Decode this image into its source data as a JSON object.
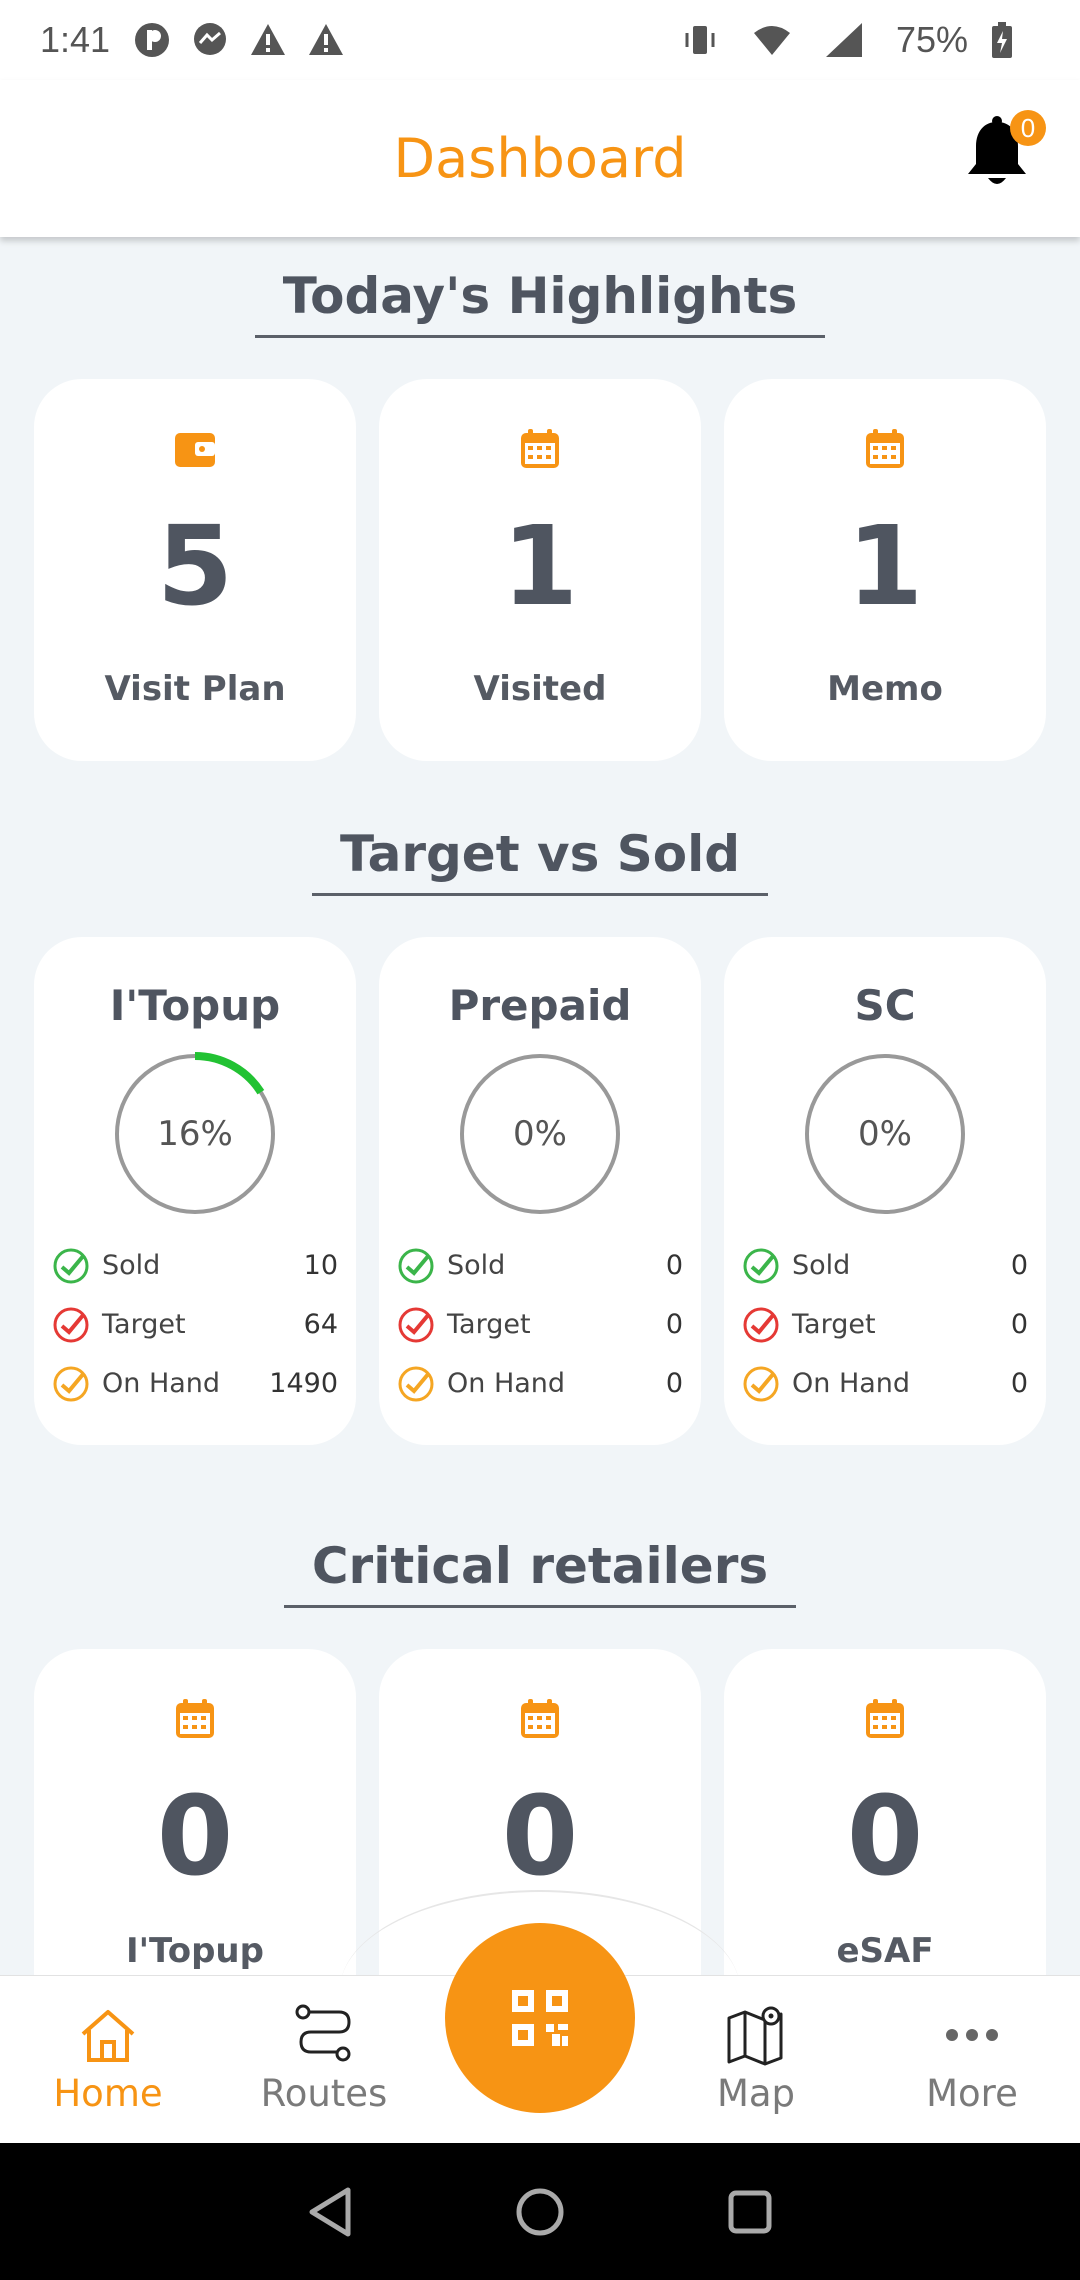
{
  "status_bar": {
    "time": "1:41",
    "battery": "75%"
  },
  "header": {
    "title": "Dashboard",
    "notification_count": "0"
  },
  "highlights": {
    "title": "Today's Highlights",
    "cards": [
      {
        "icon": "wallet-icon",
        "value": "5",
        "label": "Visit Plan"
      },
      {
        "icon": "calendar-icon",
        "value": "1",
        "label": "Visited"
      },
      {
        "icon": "calendar-icon",
        "value": "1",
        "label": "Memo"
      }
    ]
  },
  "target_vs_sold": {
    "title": "Target vs Sold",
    "cards": [
      {
        "title": "I'Topup",
        "percent_label": "16%",
        "percent": 16,
        "sold_label": "Sold",
        "sold": "10",
        "target_label": "Target",
        "target": "64",
        "onhand_label": "On Hand",
        "onhand": "1490"
      },
      {
        "title": "Prepaid",
        "percent_label": "0%",
        "percent": 0,
        "sold_label": "Sold",
        "sold": "0",
        "target_label": "Target",
        "target": "0",
        "onhand_label": "On Hand",
        "onhand": "0"
      },
      {
        "title": "SC",
        "percent_label": "0%",
        "percent": 0,
        "sold_label": "Sold",
        "sold": "0",
        "target_label": "Target",
        "target": "0",
        "onhand_label": "On Hand",
        "onhand": "0"
      }
    ]
  },
  "critical_retailers": {
    "title": "Critical retailers",
    "cards": [
      {
        "icon": "calendar-icon",
        "value": "0",
        "label": "I'Topup"
      },
      {
        "icon": "calendar-icon",
        "value": "0",
        "label": ""
      },
      {
        "icon": "calendar-icon",
        "value": "0",
        "label": "eSAF"
      }
    ]
  },
  "bottom_nav": {
    "items": [
      {
        "label": "Home",
        "icon": "home-icon",
        "active": true
      },
      {
        "label": "Routes",
        "icon": "routes-icon",
        "active": false
      },
      {
        "label": "Map",
        "icon": "map-icon",
        "active": false
      },
      {
        "label": "More",
        "icon": "more-icon",
        "active": false
      }
    ],
    "fab_icon": "qr-code-icon"
  },
  "colors": {
    "accent": "#f79414",
    "progress": "#22c233",
    "check_sold": "#3bb54a",
    "check_target": "#e53935",
    "check_onhand": "#f5a623"
  }
}
